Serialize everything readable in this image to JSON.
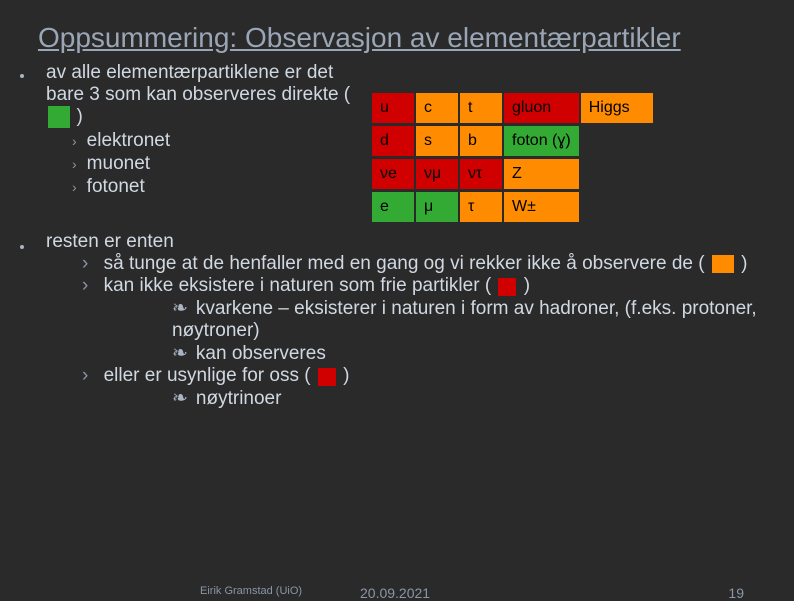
{
  "title": "Oppsummering: Observasjon av elementærpartikler",
  "block1": {
    "intro": "av alle elementærpartiklene er det bare 3 som kan observeres direkte (",
    "intro_close": ")",
    "items": [
      "elektronet",
      "muonet",
      "fotonet"
    ]
  },
  "table": {
    "rows": [
      [
        {
          "t": "u",
          "c": "c-red"
        },
        {
          "t": "c",
          "c": "c-orange"
        },
        {
          "t": "t",
          "c": "c-orange"
        },
        {
          "t": "gluon",
          "c": "c-red",
          "wide": true
        },
        {
          "t": "Higgs",
          "c": "c-orange",
          "wide": true
        }
      ],
      [
        {
          "t": "d",
          "c": "c-red"
        },
        {
          "t": "s",
          "c": "c-orange"
        },
        {
          "t": "b",
          "c": "c-orange"
        },
        {
          "t": "foton (ɣ)",
          "c": "c-green",
          "wide": true
        },
        {
          "t": "",
          "c": "",
          "wide": true
        }
      ],
      [
        {
          "t": "νe",
          "c": "c-red"
        },
        {
          "t": "νμ",
          "c": "c-red"
        },
        {
          "t": "ντ",
          "c": "c-red"
        },
        {
          "t": "Z",
          "c": "c-orange",
          "wide": true
        },
        {
          "t": "",
          "c": "",
          "wide": true
        }
      ],
      [
        {
          "t": "e",
          "c": "c-green"
        },
        {
          "t": "μ",
          "c": "c-green"
        },
        {
          "t": "τ",
          "c": "c-orange"
        },
        {
          "t": "W±",
          "c": "c-orange",
          "wide": true
        },
        {
          "t": "",
          "c": "",
          "wide": true
        }
      ]
    ]
  },
  "block2": {
    "intro": "resten er enten",
    "sub": [
      {
        "pre": "så tunge at de henfaller med en gang og vi rekker ikke å observere de (",
        "swatch": "orange",
        "post": ")"
      },
      {
        "pre": "kan ikke eksistere i naturen som frie partikler (",
        "swatch": "red",
        "post": ")"
      }
    ],
    "sub3a": "kvarkene – eksisterer i naturen i form av hadroner, (f.eks. protoner, nøytroner)",
    "sub3b": "kan observeres",
    "sub_last": {
      "pre": "eller er usynlige for oss (",
      "swatch": "red",
      "post": ")"
    },
    "sub3c": "nøytrinoer"
  },
  "footer": {
    "author": "Eirik Gramstad (UiO)",
    "date": "20.09.2021",
    "page": "19"
  }
}
